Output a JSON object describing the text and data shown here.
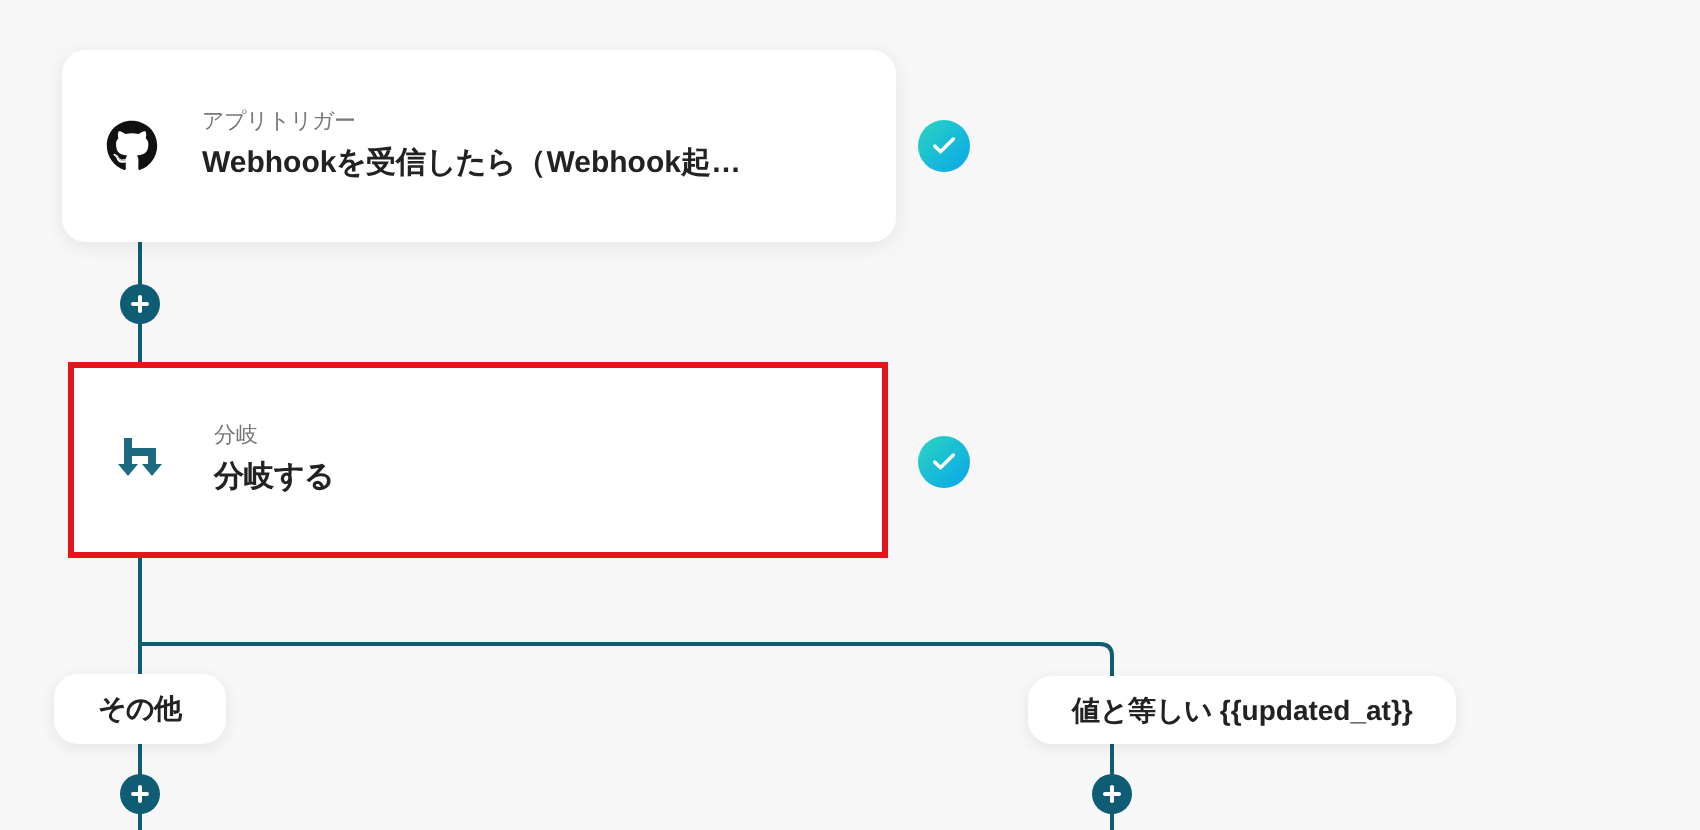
{
  "steps": [
    {
      "kind": "trigger",
      "category": "アプリトリガー",
      "title": "Webhookを受信したら（Webhook起…",
      "done": true,
      "selected": false
    },
    {
      "kind": "branch",
      "category": "分岐",
      "title": "分岐する",
      "done": true,
      "selected": true
    }
  ],
  "branches": [
    {
      "label": "その他"
    },
    {
      "label": "値と等しい {{updated_at}}"
    }
  ]
}
